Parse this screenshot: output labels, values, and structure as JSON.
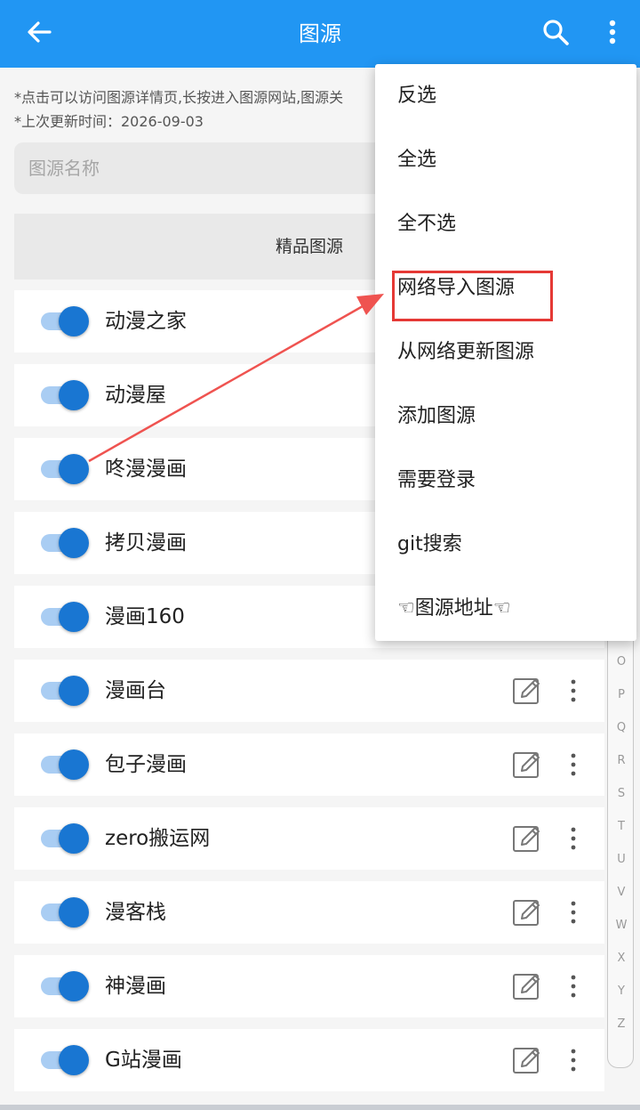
{
  "appbar": {
    "title": "图源",
    "back_icon": "arrow-left-icon",
    "search_icon": "search-icon",
    "more_icon": "more-vertical-icon",
    "color": "#2196f3"
  },
  "hints": {
    "line1": "*点击可以访问图源详情页,长按进入图源网站,图源关",
    "line2": "*上次更新时间：2026-09-03"
  },
  "search": {
    "placeholder": "图源名称",
    "value": ""
  },
  "group": {
    "title": "精品图源"
  },
  "sources": [
    {
      "name": "动漫之家",
      "enabled": true
    },
    {
      "name": "动漫屋",
      "enabled": true
    },
    {
      "name": "咚漫漫画",
      "enabled": true
    },
    {
      "name": "拷贝漫画",
      "enabled": true
    },
    {
      "name": "漫画160",
      "enabled": true
    },
    {
      "name": "漫画台",
      "enabled": true
    },
    {
      "name": "包子漫画",
      "enabled": true
    },
    {
      "name": "zero搬运网",
      "enabled": true
    },
    {
      "name": "漫客栈",
      "enabled": true
    },
    {
      "name": "神漫画",
      "enabled": true
    },
    {
      "name": "G站漫画",
      "enabled": true
    }
  ],
  "menu": {
    "items": [
      "反选",
      "全选",
      "全不选",
      "网络导入图源",
      "从网络更新图源",
      "添加图源",
      "需要登录",
      "git搜索",
      "☜图源地址☜"
    ],
    "highlighted_index": 3,
    "highlight_color": "#e53935"
  },
  "index_letters": [
    "O",
    "P",
    "Q",
    "R",
    "S",
    "T",
    "U",
    "V",
    "W",
    "X",
    "Y",
    "Z"
  ],
  "toggle_color": "#1976d2"
}
